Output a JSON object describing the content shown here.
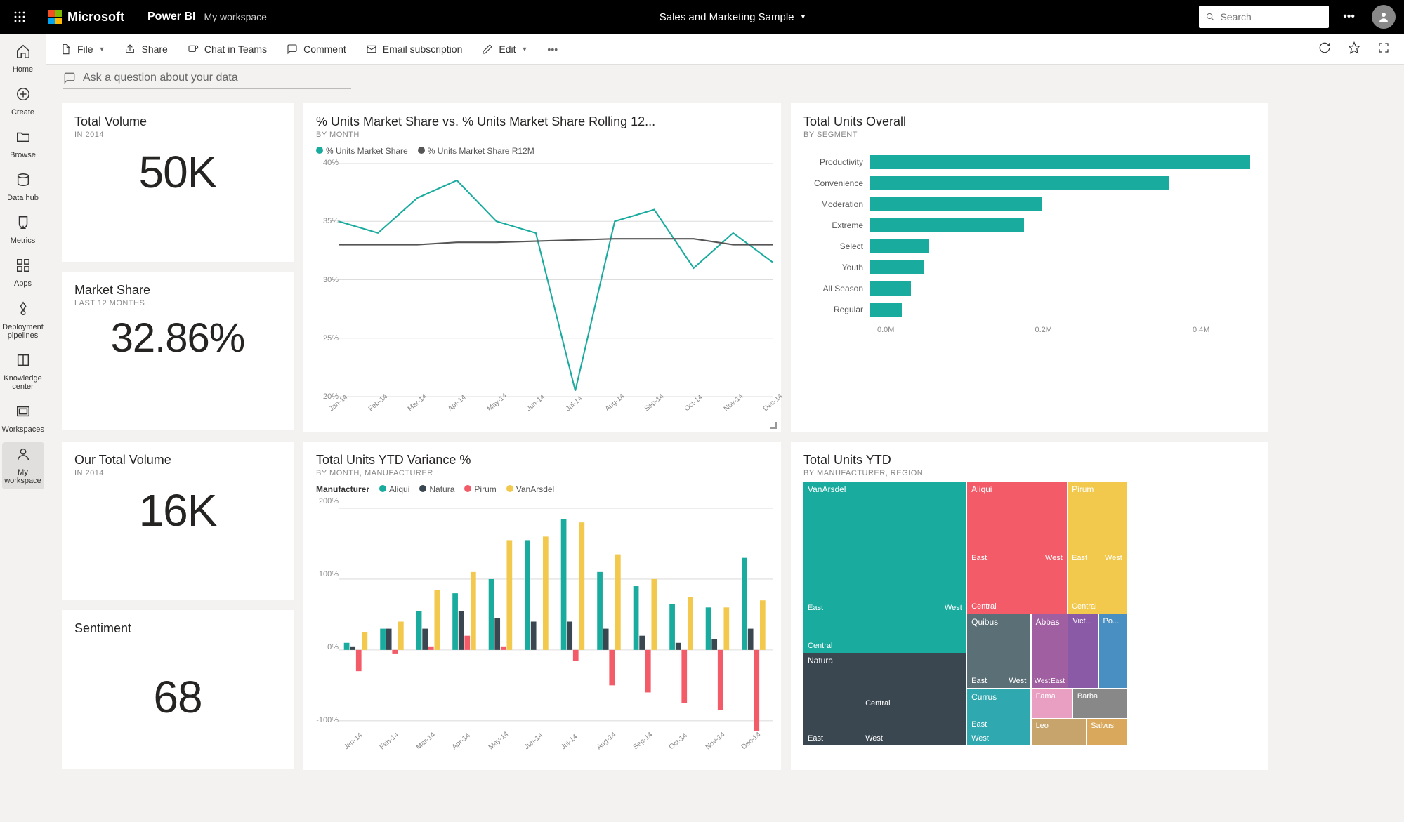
{
  "topbar": {
    "microsoft": "Microsoft",
    "brand": "Power BI",
    "workspace": "My workspace",
    "dashboard": "Sales and Marketing Sample",
    "search_placeholder": "Search"
  },
  "leftnav": [
    {
      "id": "home",
      "label": "Home"
    },
    {
      "id": "create",
      "label": "Create"
    },
    {
      "id": "browse",
      "label": "Browse"
    },
    {
      "id": "datahub",
      "label": "Data hub"
    },
    {
      "id": "metrics",
      "label": "Metrics"
    },
    {
      "id": "apps",
      "label": "Apps"
    },
    {
      "id": "deploy",
      "label": "Deployment pipelines"
    },
    {
      "id": "knowledge",
      "label": "Knowledge center"
    },
    {
      "id": "workspaces",
      "label": "Workspaces"
    },
    {
      "id": "myworkspace",
      "label": "My workspace"
    }
  ],
  "cmdbar": {
    "file": "File",
    "share": "Share",
    "chat": "Chat in Teams",
    "comment": "Comment",
    "email": "Email subscription",
    "edit": "Edit"
  },
  "qna_placeholder": "Ask a question about your data",
  "kpis": {
    "total_volume": {
      "title": "Total Volume",
      "sub": "IN 2014",
      "value": "50K"
    },
    "market_share": {
      "title": "Market Share",
      "sub": "LAST 12 MONTHS",
      "value": "32.86%"
    },
    "our_volume": {
      "title": "Our Total Volume",
      "sub": "IN 2014",
      "value": "16K"
    },
    "sentiment": {
      "title": "Sentiment",
      "value": "68"
    }
  },
  "chart_data": [
    {
      "id": "line_share",
      "type": "line",
      "title": "% Units Market Share vs. % Units Market Share Rolling 12...",
      "sub": "BY MONTH",
      "legend": [
        "% Units Market Share",
        "% Units Market Share R12M"
      ],
      "colors": [
        "#1aab9f",
        "#555"
      ],
      "categories": [
        "Jan-14",
        "Feb-14",
        "Mar-14",
        "Apr-14",
        "May-14",
        "Jun-14",
        "Jul-14",
        "Aug-14",
        "Sep-14",
        "Oct-14",
        "Nov-14",
        "Dec-14"
      ],
      "series": [
        {
          "name": "% Units Market Share",
          "values": [
            35,
            34,
            37,
            38.5,
            35,
            34,
            20.5,
            35,
            36,
            31,
            34,
            31.5
          ]
        },
        {
          "name": "% Units Market Share R12M",
          "values": [
            33,
            33,
            33,
            33.2,
            33.2,
            33.3,
            33.4,
            33.5,
            33.5,
            33.5,
            33,
            33
          ]
        }
      ],
      "ylim": [
        20,
        40
      ],
      "yticks": [
        "20%",
        "25%",
        "30%",
        "35%",
        "40%"
      ]
    },
    {
      "id": "hbar_segment",
      "type": "bar",
      "orientation": "horizontal",
      "title": "Total Units Overall",
      "sub": "BY SEGMENT",
      "categories": [
        "Productivity",
        "Convenience",
        "Moderation",
        "Extreme",
        "Select",
        "Youth",
        "All Season",
        "Regular"
      ],
      "values": [
        0.42,
        0.33,
        0.19,
        0.17,
        0.065,
        0.06,
        0.045,
        0.035
      ],
      "xlim": [
        0,
        0.5
      ],
      "xticks": [
        "0.0M",
        "0.2M",
        "0.4M"
      ],
      "color": "#1aab9f"
    },
    {
      "id": "clustered_variance",
      "type": "bar",
      "title": "Total Units YTD Variance %",
      "sub": "BY MONTH, MANUFACTURER",
      "legend_label": "Manufacturer",
      "legend": [
        "Aliqui",
        "Natura",
        "Pirum",
        "VanArsdel"
      ],
      "colors": [
        "#1aab9f",
        "#3a4750",
        "#f45b69",
        "#f2c94c"
      ],
      "categories": [
        "Jan-14",
        "Feb-14",
        "Mar-14",
        "Apr-14",
        "May-14",
        "Jun-14",
        "Jul-14",
        "Aug-14",
        "Sep-14",
        "Oct-14",
        "Nov-14",
        "Dec-14"
      ],
      "series": [
        {
          "name": "Aliqui",
          "values": [
            10,
            30,
            55,
            80,
            100,
            155,
            185,
            110,
            90,
            65,
            60,
            130
          ]
        },
        {
          "name": "Natura",
          "values": [
            5,
            30,
            30,
            55,
            45,
            40,
            40,
            30,
            20,
            10,
            15,
            30
          ]
        },
        {
          "name": "Pirum",
          "values": [
            -30,
            -5,
            5,
            20,
            5,
            0,
            -15,
            -50,
            -60,
            -75,
            -85,
            -115
          ]
        },
        {
          "name": "VanArsdel",
          "values": [
            25,
            40,
            85,
            110,
            155,
            160,
            180,
            135,
            100,
            75,
            60,
            70
          ]
        }
      ],
      "ylim": [
        -120,
        200
      ],
      "yticks": [
        "-100%",
        "0%",
        "100%",
        "200%"
      ]
    },
    {
      "id": "treemap_ytd",
      "type": "treemap",
      "title": "Total Units YTD",
      "sub": "BY MANUFACTURER, REGION",
      "nodes": [
        {
          "name": "VanArsdel",
          "color": "#1aab9f",
          "children": [
            "East",
            "West",
            "Central"
          ]
        },
        {
          "name": "Natura",
          "color": "#3a4750",
          "children": [
            "East",
            "Central",
            "West"
          ]
        },
        {
          "name": "Aliqui",
          "color": "#f45b69",
          "children": [
            "East",
            "West",
            "Central"
          ]
        },
        {
          "name": "Quibus",
          "color": "#5b6f77",
          "children": [
            "East",
            "West"
          ]
        },
        {
          "name": "Currus",
          "color": "#2fa8b0",
          "children": [
            "East",
            "West"
          ]
        },
        {
          "name": "Pirum",
          "color": "#f2c94c",
          "children": [
            "East",
            "West",
            "Central"
          ]
        },
        {
          "name": "Abbas",
          "color": "#a05fa0",
          "children": [
            "West",
            "East"
          ]
        },
        {
          "name": "Fama",
          "color": "#e89fc1",
          "children": []
        },
        {
          "name": "Leo",
          "color": "#c7a46b",
          "children": []
        },
        {
          "name": "Victoria",
          "color": "#8a5aa6",
          "children": []
        },
        {
          "name": "Pomum",
          "color": "#4a8fc2",
          "children": []
        },
        {
          "name": "Barba",
          "color": "#888",
          "children": []
        },
        {
          "name": "Salvus",
          "color": "#d9a85c",
          "children": []
        }
      ]
    }
  ]
}
